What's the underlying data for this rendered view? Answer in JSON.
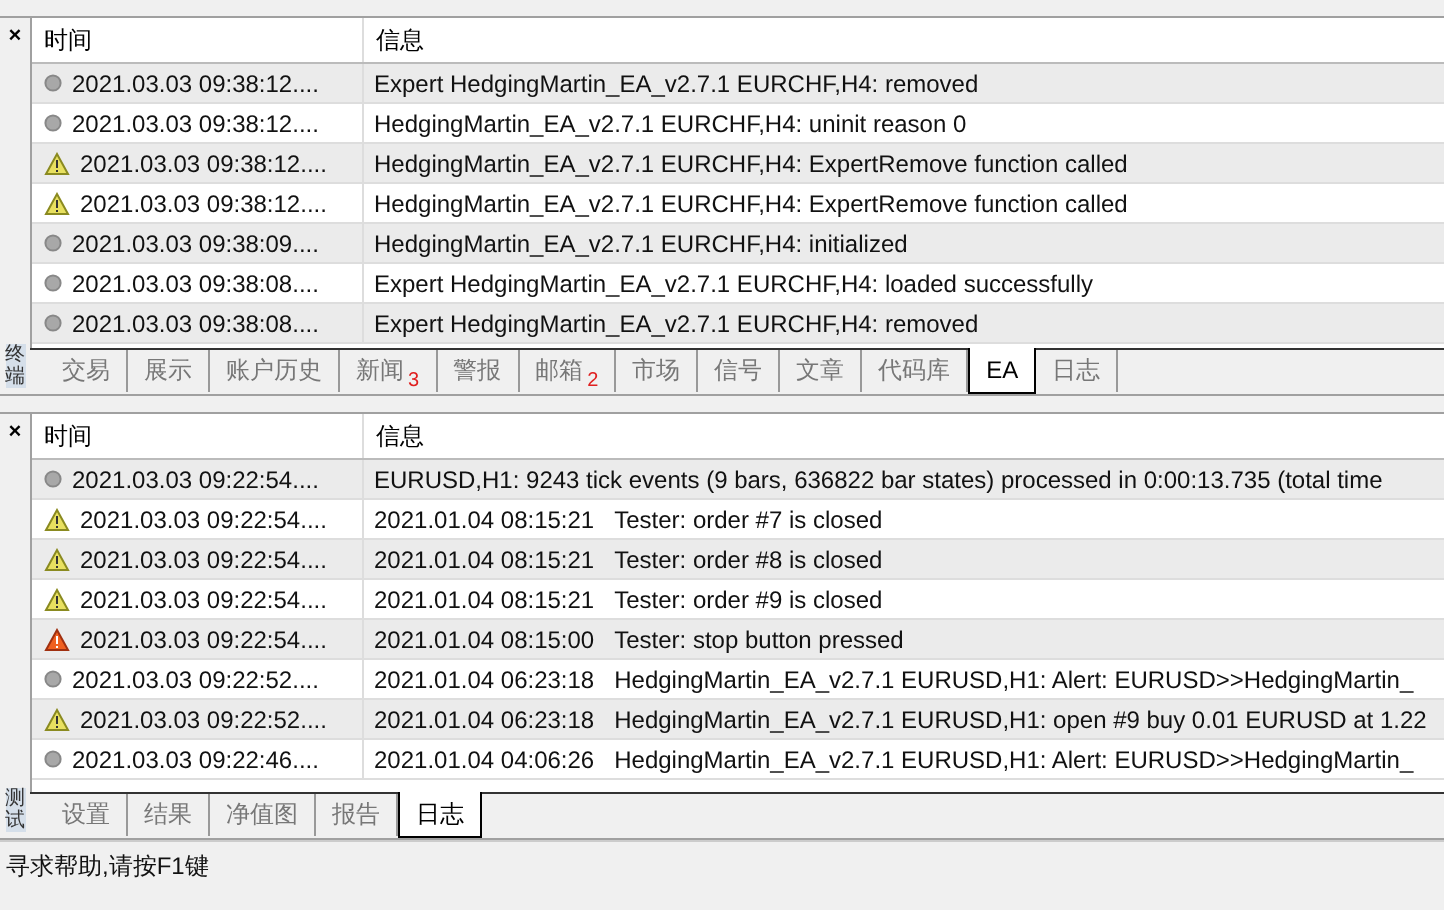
{
  "panels": [
    {
      "side_label": "终端",
      "close": "×",
      "columns": [
        "时间",
        "信息"
      ],
      "rows": [
        {
          "kind": "info",
          "time": "2021.03.03 09:38:12....",
          "message": "Expert HedgingMartin_EA_v2.7.1 EURCHF,H4: removed"
        },
        {
          "kind": "info",
          "time": "2021.03.03 09:38:12....",
          "message": "HedgingMartin_EA_v2.7.1 EURCHF,H4: uninit reason 0"
        },
        {
          "kind": "warning",
          "time": "2021.03.03 09:38:12....",
          "message": "HedgingMartin_EA_v2.7.1 EURCHF,H4: ExpertRemove function called"
        },
        {
          "kind": "warning",
          "time": "2021.03.03 09:38:12....",
          "message": "HedgingMartin_EA_v2.7.1 EURCHF,H4: ExpertRemove function called"
        },
        {
          "kind": "info",
          "time": "2021.03.03 09:38:09....",
          "message": "HedgingMartin_EA_v2.7.1 EURCHF,H4: initialized"
        },
        {
          "kind": "info",
          "time": "2021.03.03 09:38:08....",
          "message": "Expert HedgingMartin_EA_v2.7.1 EURCHF,H4: loaded successfully"
        },
        {
          "kind": "info",
          "time": "2021.03.03 09:38:08....",
          "message": "Expert HedgingMartin_EA_v2.7.1 EURCHF,H4: removed"
        }
      ],
      "tabs": [
        {
          "label": "交易",
          "selected": false
        },
        {
          "label": "展示",
          "selected": false
        },
        {
          "label": "账户历史",
          "selected": false
        },
        {
          "label": "新闻",
          "badge": "3",
          "selected": false
        },
        {
          "label": "警报",
          "selected": false
        },
        {
          "label": "邮箱",
          "badge": "2",
          "selected": false
        },
        {
          "label": "市场",
          "selected": false
        },
        {
          "label": "信号",
          "selected": false
        },
        {
          "label": "文章",
          "selected": false
        },
        {
          "label": "代码库",
          "selected": false
        },
        {
          "label": "EA",
          "selected": true
        },
        {
          "label": "日志",
          "selected": false
        }
      ]
    },
    {
      "side_label": "测试",
      "close": "×",
      "columns": [
        "时间",
        "信息"
      ],
      "rows": [
        {
          "kind": "info",
          "time": "2021.03.03 09:22:54....",
          "message": "EURUSD,H1: 9243 tick events (9 bars, 636822 bar states) processed in 0:00:13.735 (total time"
        },
        {
          "kind": "warning",
          "time": "2021.03.03 09:22:54....",
          "msg_time": "2021.01.04 08:15:21",
          "message": "Tester: order #7 is closed"
        },
        {
          "kind": "warning",
          "time": "2021.03.03 09:22:54....",
          "msg_time": "2021.01.04 08:15:21",
          "message": "Tester: order #8 is closed"
        },
        {
          "kind": "warning",
          "time": "2021.03.03 09:22:54....",
          "msg_time": "2021.01.04 08:15:21",
          "message": "Tester: order #9 is closed"
        },
        {
          "kind": "error",
          "time": "2021.03.03 09:22:54....",
          "msg_time": "2021.01.04 08:15:00",
          "message": "Tester: stop button pressed"
        },
        {
          "kind": "info",
          "time": "2021.03.03 09:22:52....",
          "msg_time": "2021.01.04 06:23:18",
          "message": "HedgingMartin_EA_v2.7.1 EURUSD,H1: Alert: EURUSD>>HedgingMartin_"
        },
        {
          "kind": "warning",
          "time": "2021.03.03 09:22:52....",
          "msg_time": "2021.01.04 06:23:18",
          "message": "HedgingMartin_EA_v2.7.1 EURUSD,H1: open #9 buy 0.01 EURUSD at 1.22"
        },
        {
          "kind": "info",
          "time": "2021.03.03 09:22:46....",
          "msg_time": "2021.01.04 04:06:26",
          "message": "HedgingMartin_EA_v2.7.1 EURUSD,H1: Alert: EURUSD>>HedgingMartin_"
        }
      ],
      "tabs": [
        {
          "label": "设置",
          "selected": false
        },
        {
          "label": "结果",
          "selected": false
        },
        {
          "label": "净值图",
          "selected": false
        },
        {
          "label": "报告",
          "selected": false
        },
        {
          "label": "日志",
          "selected": true
        }
      ]
    }
  ],
  "status_bar": "寻求帮助,请按F1键"
}
